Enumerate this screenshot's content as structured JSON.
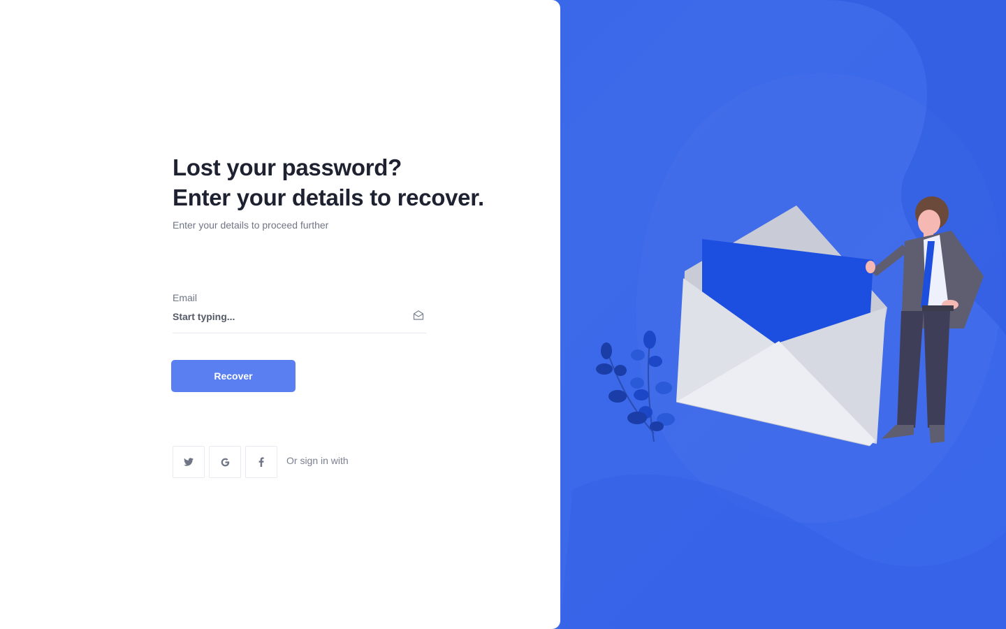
{
  "heading": {
    "line1": "Lost your password?",
    "line2": "Enter your details to recover."
  },
  "subtitle": "Enter your details to proceed further",
  "form": {
    "email_label": "Email",
    "email_placeholder": "Start typing...",
    "email_value": "",
    "submit_label": "Recover"
  },
  "social": {
    "text": "Or sign in with",
    "providers": [
      {
        "name": "twitter",
        "icon": "twitter-icon"
      },
      {
        "name": "google",
        "icon": "google-icon"
      },
      {
        "name": "facebook",
        "icon": "facebook-icon"
      }
    ]
  },
  "colors": {
    "accent": "#5a7ff0",
    "panel_blue": "#2e5fe6",
    "heading": "#1e2230",
    "muted_text": "#6f7585"
  },
  "illustration": {
    "icon": "envelope-with-person-illustration"
  }
}
